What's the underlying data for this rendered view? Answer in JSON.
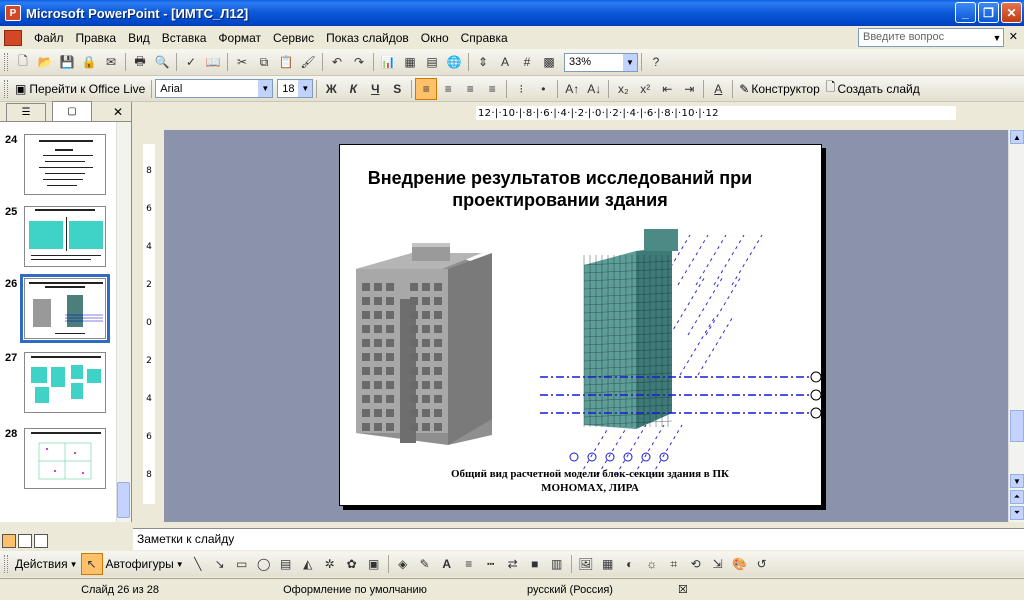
{
  "window": {
    "title": "Microsoft PowerPoint - [ИМТС_Л12]",
    "icon": "powerpoint-app-icon"
  },
  "menu": {
    "items": [
      "Файл",
      "Правка",
      "Вид",
      "Вставка",
      "Формат",
      "Сервис",
      "Показ слайдов",
      "Окно",
      "Справка"
    ],
    "help_placeholder": "Введите вопрос"
  },
  "toolbar_standard": {
    "zoom": "33%"
  },
  "toolbar_formatting": {
    "office_live": "Перейти к Office Live",
    "font": "Arial",
    "font_size": "18",
    "bold": "Ж",
    "italic": "К",
    "underline": "Ч",
    "shadow": "S",
    "designer": "Конструктор",
    "new_slide": "Создать слайд"
  },
  "ruler": {
    "horizontal": "12·|·10·|·8·|·6·|·4·|·2·|·0·|·2·|·4·|·6·|·8·|·10·|·12",
    "vertical": [
      "8",
      "6",
      "4",
      "2",
      "0",
      "2",
      "4",
      "6",
      "8"
    ]
  },
  "thumbnails": [
    {
      "number": "24"
    },
    {
      "number": "25"
    },
    {
      "number": "26",
      "selected": true
    },
    {
      "number": "27"
    },
    {
      "number": "28"
    }
  ],
  "slide": {
    "title_line1": "Внедрение результатов исследований при",
    "title_line2": "проектировании здания",
    "caption_line1": "Общий вид расчетной модели блок-секции здания в ПК",
    "caption_line2": "МОНОМАХ, ЛИРА"
  },
  "notes_placeholder": "Заметки к слайду",
  "drawing_toolbar": {
    "actions": "Действия",
    "autoshapes": "Автофигуры"
  },
  "status": {
    "slide": "Слайд 26 из 28",
    "design": "Оформление по умолчанию",
    "language": "русский (Россия)"
  },
  "colors": {
    "title_bar": "#0a58d8",
    "workspace": "#8b93aa",
    "model_teal": "#5f9e98"
  }
}
